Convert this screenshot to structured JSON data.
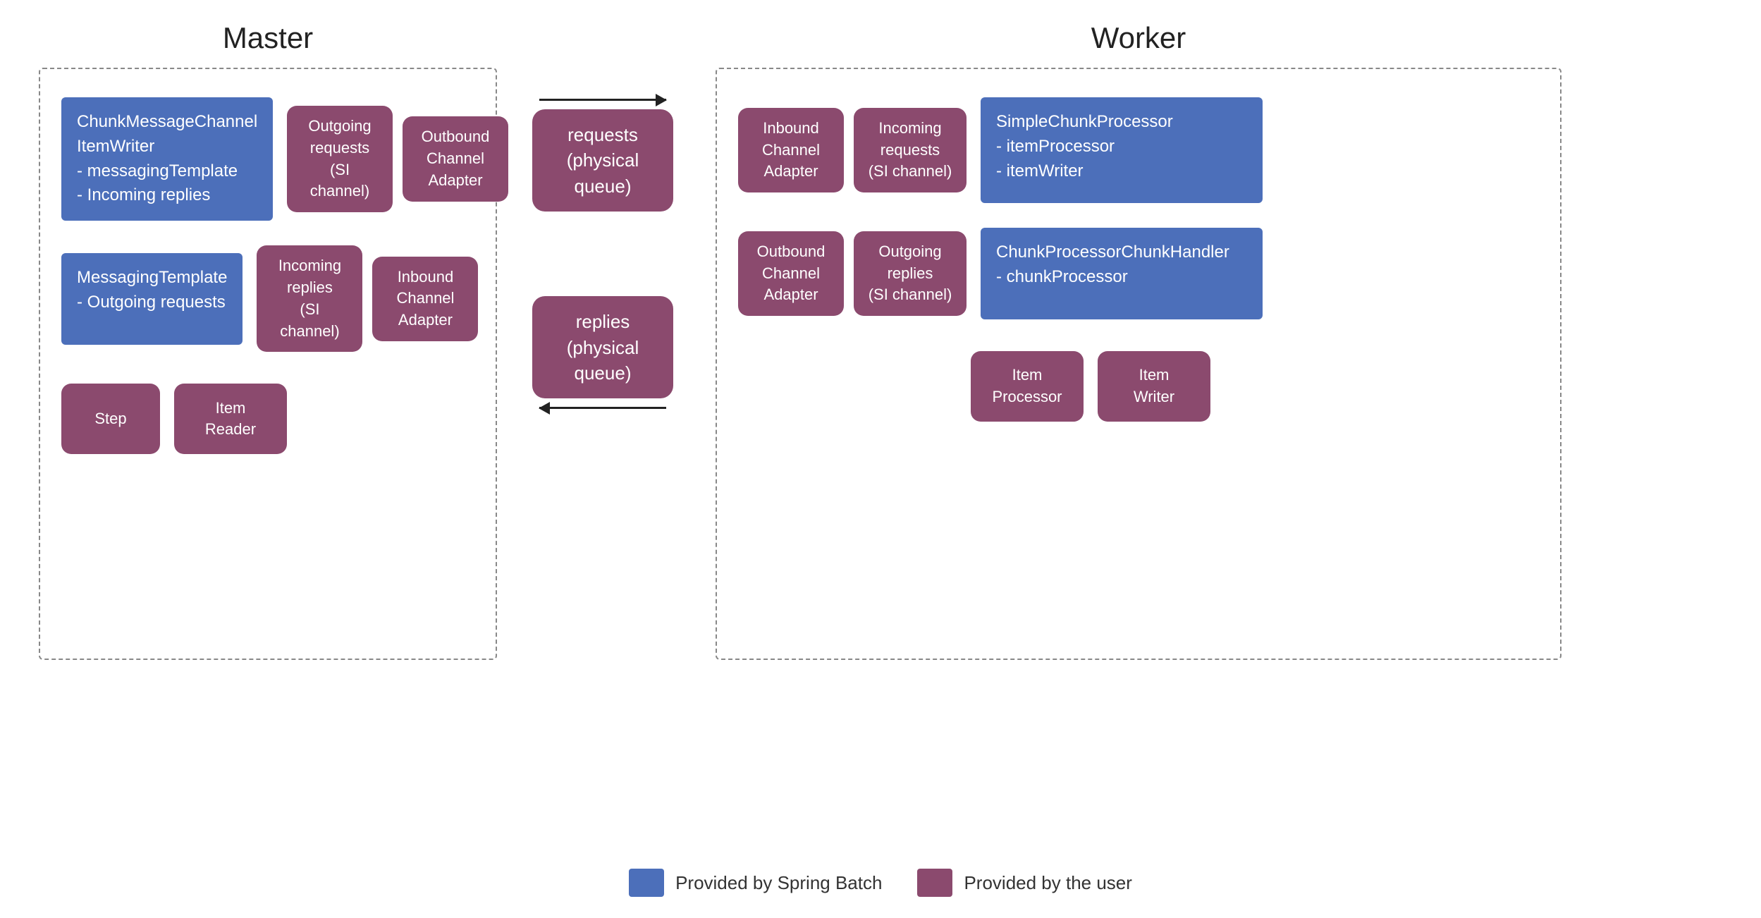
{
  "page": {
    "master_title": "Master",
    "worker_title": "Worker",
    "legend": {
      "spring_batch_label": "Provided by Spring Batch",
      "user_label": "Provided by the user"
    },
    "master": {
      "blue_box_1": {
        "line1": "ChunkMessageChannel",
        "line2": "ItemWriter",
        "line3": "- messagingTemplate",
        "line4": "- Incoming replies"
      },
      "blue_box_2": {
        "line1": "MessagingTemplate",
        "line2": "- Outgoing requests"
      },
      "channel1_label": "Outgoing requests\n(SI channel)",
      "adapter1_label": "Outbound\nChannel\nAdapter",
      "channel2_label": "Incoming\nreplies\n(SI channel)",
      "adapter2_label": "Inbound\nChannel\nAdapter",
      "step_label": "Step",
      "item_reader_label": "Item\nReader"
    },
    "middle": {
      "requests_queue_label": "requests\n(physical queue)",
      "replies_queue_label": "replies\n(physical queue)"
    },
    "worker": {
      "adapter3_label": "Inbound\nChannel\nAdapter",
      "channel3_label": "Incoming\nrequests\n(SI channel)",
      "blue_box_3": {
        "line1": "SimpleChunkProcessor",
        "line2": "- itemProcessor",
        "line3": "- itemWriter"
      },
      "adapter4_label": "Outbound\nChannel\nAdapter",
      "channel4_label": "Outgoing\nreplies\n(SI channel)",
      "blue_box_4": {
        "line1": "ChunkProcessorChunkHandler",
        "line2": "- chunkProcessor"
      },
      "item_processor_label": "Item\nProcessor",
      "item_writer_label": "Item\nWriter"
    }
  }
}
